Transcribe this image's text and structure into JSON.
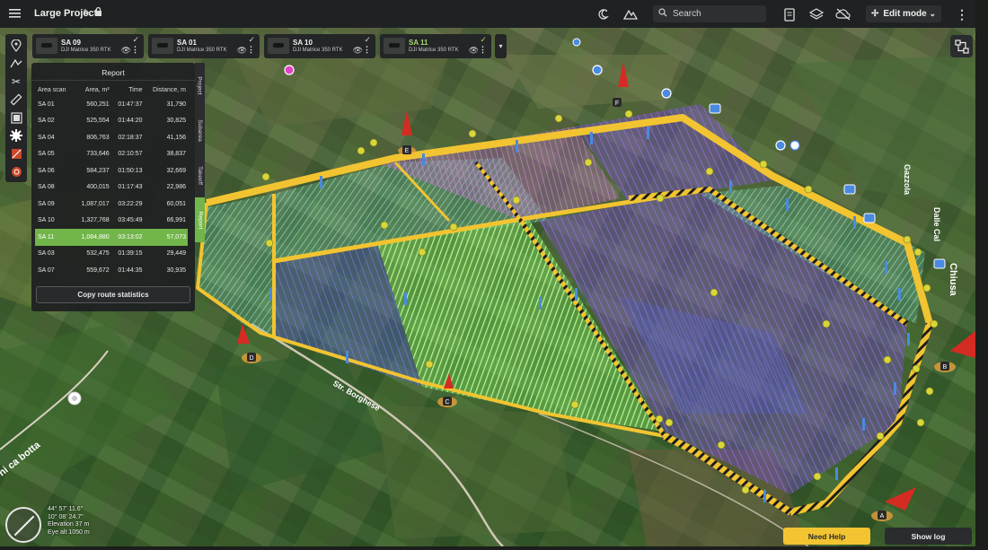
{
  "topbar": {
    "project_title": "Large Project",
    "search_placeholder": "Search",
    "mode_label": "Edit mode"
  },
  "scan_cards": [
    {
      "name": "SA 09",
      "model": "DJI Matrice 350 RTK",
      "selected": false
    },
    {
      "name": "SA 01",
      "model": "DJI Matrice 350 RTK",
      "selected": false
    },
    {
      "name": "SA 10",
      "model": "DJI Matrice 350 RTK",
      "selected": false
    },
    {
      "name": "SA 11",
      "model": "DJI Matrice 350 RTK",
      "selected": true
    }
  ],
  "report": {
    "title": "Report",
    "columns": [
      "Area scan",
      "Area, m²",
      "Time",
      "Distance, m"
    ],
    "rows": [
      [
        "SA 01",
        "560,251",
        "01:47:37",
        "31,790"
      ],
      [
        "SA 02",
        "525,554",
        "01:44:20",
        "30,825"
      ],
      [
        "SA 04",
        "806,763",
        "02:18:37",
        "41,156"
      ],
      [
        "SA 05",
        "733,646",
        "02:10:57",
        "38,837"
      ],
      [
        "SA 06",
        "584,237",
        "01:50:13",
        "32,669"
      ],
      [
        "SA 08",
        "400,015",
        "01:17:43",
        "22,986"
      ],
      [
        "SA 09",
        "1,087,017",
        "03:22:29",
        "60,051"
      ],
      [
        "SA 10",
        "1,327,768",
        "03:45:49",
        "66,991"
      ],
      [
        "SA 11",
        "1,084,880",
        "03:13:02",
        "57,073"
      ],
      [
        "SA 03",
        "532,475",
        "01:39:15",
        "29,449"
      ],
      [
        "SA 07",
        "559,672",
        "01:44:35",
        "30,935"
      ]
    ],
    "highlighted_row": 8,
    "copy_button_label": "Copy route statistics"
  },
  "side_tabs": [
    "Project",
    "Subarea",
    "Takeoff",
    "Report"
  ],
  "side_tab_active": 3,
  "map_labels": {
    "road_1": "Str. Borghese",
    "road_2": "ni ca botta",
    "place_1": "Chiusa",
    "place_2": "Gazzola",
    "place_3": "Dalle Cal"
  },
  "markers": [
    "A",
    "B",
    "C",
    "D",
    "E",
    "F"
  ],
  "status": {
    "coords_lat": "44° 57' 11.6\"",
    "coords_lon": "10° 08' 24.7\"",
    "elevation": "Elevation 37 m",
    "eye_alt": "Eye alt 1050 m"
  },
  "footer": {
    "help_label": "Need Help",
    "log_label": "Show log"
  },
  "colors": {
    "accent_green": "#72b54a",
    "selected_text": "#a4d96c",
    "boundary_yellow": "#f2c431",
    "route_green": "#8fe36b",
    "route_purple": "#8a5bd0",
    "route_blue": "#5b7bd8",
    "marker_red": "#d42b22"
  },
  "icons": {
    "menu": "menu-icon",
    "edit": "pencil-icon",
    "lock": "lock-icon",
    "weather": "weather-icon",
    "terrain": "terrain-icon",
    "search": "search-icon",
    "report": "clipboard-icon",
    "layers": "layers-icon",
    "offline": "cloud-off-icon",
    "flow": "flow-icon"
  }
}
